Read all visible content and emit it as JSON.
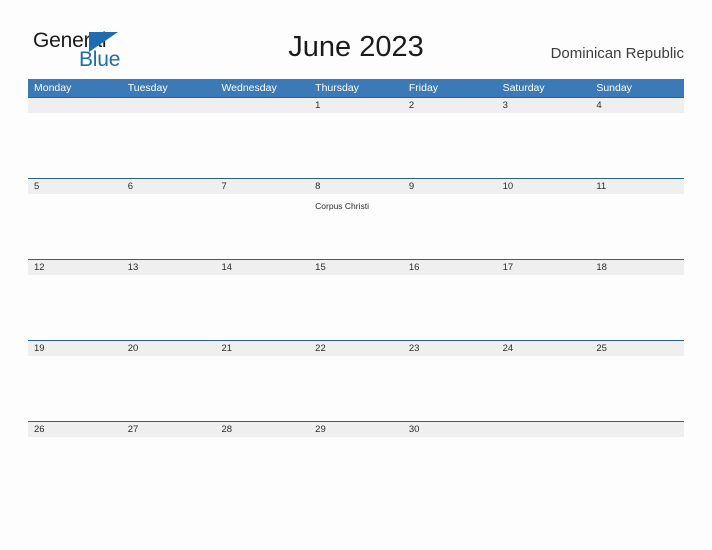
{
  "brand": {
    "name_part1": "General",
    "name_part2": "Blue",
    "flag_icon": "blue-triangle-flag-icon",
    "dark_color": "#1b1b1b",
    "blue_color": "#1f6cb0"
  },
  "header": {
    "title": "June 2023",
    "country": "Dominican Republic"
  },
  "theme": {
    "header_blue": "#3b79b7",
    "band_gray": "#efeff0",
    "band_border": "#2f5f8f",
    "page_background": "#fdfdfd",
    "text_color": "#2b2b2b"
  },
  "calendar": {
    "weekdays": [
      "Monday",
      "Tuesday",
      "Wednesday",
      "Thursday",
      "Friday",
      "Saturday",
      "Sunday"
    ],
    "weeks": [
      {
        "days": [
          {
            "num": "",
            "event": ""
          },
          {
            "num": "",
            "event": ""
          },
          {
            "num": "",
            "event": ""
          },
          {
            "num": "1",
            "event": ""
          },
          {
            "num": "2",
            "event": ""
          },
          {
            "num": "3",
            "event": ""
          },
          {
            "num": "4",
            "event": ""
          }
        ]
      },
      {
        "days": [
          {
            "num": "5",
            "event": ""
          },
          {
            "num": "6",
            "event": ""
          },
          {
            "num": "7",
            "event": ""
          },
          {
            "num": "8",
            "event": "Corpus Christi"
          },
          {
            "num": "9",
            "event": ""
          },
          {
            "num": "10",
            "event": ""
          },
          {
            "num": "11",
            "event": ""
          }
        ]
      },
      {
        "days": [
          {
            "num": "12",
            "event": ""
          },
          {
            "num": "13",
            "event": ""
          },
          {
            "num": "14",
            "event": ""
          },
          {
            "num": "15",
            "event": ""
          },
          {
            "num": "16",
            "event": ""
          },
          {
            "num": "17",
            "event": ""
          },
          {
            "num": "18",
            "event": ""
          }
        ]
      },
      {
        "days": [
          {
            "num": "19",
            "event": ""
          },
          {
            "num": "20",
            "event": ""
          },
          {
            "num": "21",
            "event": ""
          },
          {
            "num": "22",
            "event": ""
          },
          {
            "num": "23",
            "event": ""
          },
          {
            "num": "24",
            "event": ""
          },
          {
            "num": "25",
            "event": ""
          }
        ]
      },
      {
        "days": [
          {
            "num": "26",
            "event": ""
          },
          {
            "num": "27",
            "event": ""
          },
          {
            "num": "28",
            "event": ""
          },
          {
            "num": "29",
            "event": ""
          },
          {
            "num": "30",
            "event": ""
          },
          {
            "num": "",
            "event": ""
          },
          {
            "num": "",
            "event": ""
          }
        ]
      }
    ]
  }
}
